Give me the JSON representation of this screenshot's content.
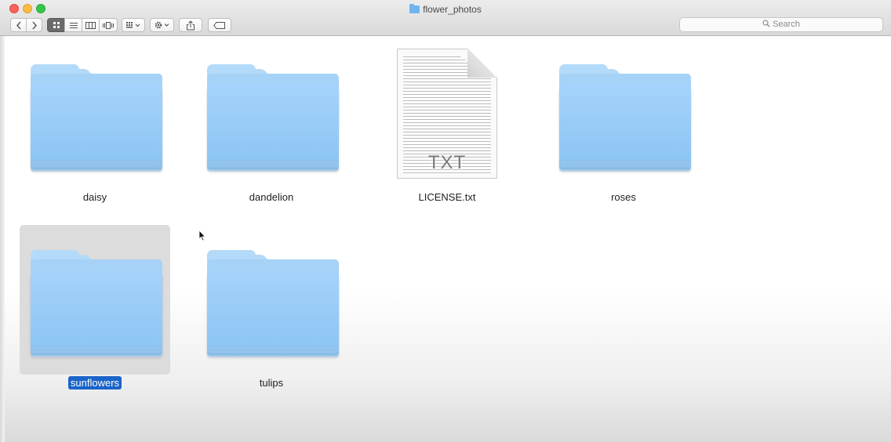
{
  "window": {
    "title": "flower_photos"
  },
  "toolbar": {
    "back_icon": "chevron-left-icon",
    "forward_icon": "chevron-right-icon",
    "view_modes": [
      "icon-view",
      "list-view",
      "column-view",
      "cover-flow-view"
    ],
    "active_view": "icon-view",
    "group_icon": "arrange-grid-icon",
    "action_icon": "gear-icon",
    "share_icon": "share-icon",
    "tag_icon": "tag-icon"
  },
  "search": {
    "placeholder": "Search"
  },
  "items": [
    {
      "name": "daisy",
      "kind": "folder"
    },
    {
      "name": "dandelion",
      "kind": "folder"
    },
    {
      "name": "LICENSE.txt",
      "kind": "text-file",
      "ext": "TXT"
    },
    {
      "name": "roses",
      "kind": "folder"
    },
    {
      "name": "sunflowers",
      "kind": "folder",
      "selected": true
    },
    {
      "name": "tulips",
      "kind": "folder"
    }
  ],
  "colors": {
    "folder": "#a5d3fb",
    "selection": "#1a64c9"
  }
}
